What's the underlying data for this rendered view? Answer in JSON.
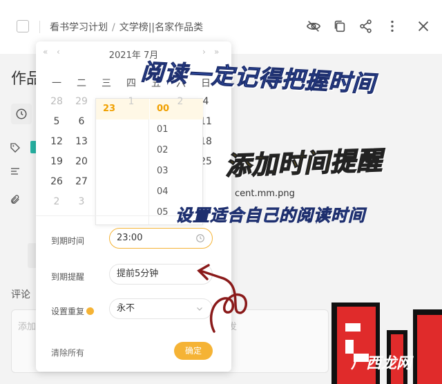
{
  "header": {
    "breadcrumb_project": "看书学习计划",
    "breadcrumb_sep": "/",
    "breadcrumb_list": "文学榜||名家作品类",
    "icons": [
      "eye-off-icon",
      "copy-icon",
      "share-icon",
      "more-icon",
      "close-icon"
    ]
  },
  "background": {
    "title_partial": "作品",
    "attachment_partial": "cent.mm.png",
    "comment_label": "评论",
    "comment_placeholder_start": "添加",
    "comment_placeholder_end": "发",
    "tag_color": "#26b3a4"
  },
  "calendar": {
    "month_label": "2021年 7月",
    "nav": {
      "prev_year": "«",
      "prev_month": "‹",
      "next_month": "›",
      "next_year": "»"
    },
    "weekdays": [
      "一",
      "二",
      "三",
      "四",
      "五",
      "六",
      "日"
    ],
    "visible_cells": [
      {
        "col": 0,
        "row": 0,
        "text": "28",
        "dim": true
      },
      {
        "col": 1,
        "row": 0,
        "text": "29",
        "dim": true
      },
      {
        "col": 6,
        "row": 0,
        "text": "4"
      },
      {
        "col": 0,
        "row": 1,
        "text": "5"
      },
      {
        "col": 1,
        "row": 1,
        "text": "6"
      },
      {
        "col": 6,
        "row": 1,
        "text": "11"
      },
      {
        "col": 0,
        "row": 2,
        "text": "12"
      },
      {
        "col": 1,
        "row": 2,
        "text": "13"
      },
      {
        "col": 6,
        "row": 2,
        "text": "18"
      },
      {
        "col": 0,
        "row": 3,
        "text": "19"
      },
      {
        "col": 1,
        "row": 3,
        "text": "20"
      },
      {
        "col": 6,
        "row": 3,
        "text": "25"
      },
      {
        "col": 0,
        "row": 4,
        "text": "26"
      },
      {
        "col": 1,
        "row": 4,
        "text": "27"
      },
      {
        "col": 0,
        "row": 5,
        "text": "2",
        "dim": true
      },
      {
        "col": 1,
        "row": 5,
        "text": "3",
        "dim": true
      }
    ],
    "time_picker": {
      "hours": [
        "23"
      ],
      "minutes": [
        "00",
        "01",
        "02",
        "03",
        "04",
        "05"
      ],
      "selected_hour": "23",
      "selected_minute": "00",
      "peek_hour": "1",
      "peek_minute": "2"
    }
  },
  "form": {
    "due_time_label": "到期时间",
    "due_time_value": "23:00",
    "reminder_label": "到期提醒",
    "reminder_value": "提前5分钟",
    "repeat_label": "设置重复",
    "repeat_value": "永不",
    "clear_all": "清除所有",
    "confirm": "确定",
    "accent_color": "#f5b335"
  },
  "overlay": {
    "caption1": "阅读一定记得把握时间",
    "caption2": "添加时间提醒",
    "caption3": "设置适合自己的阅读时间",
    "watermark": "广西龙网"
  }
}
